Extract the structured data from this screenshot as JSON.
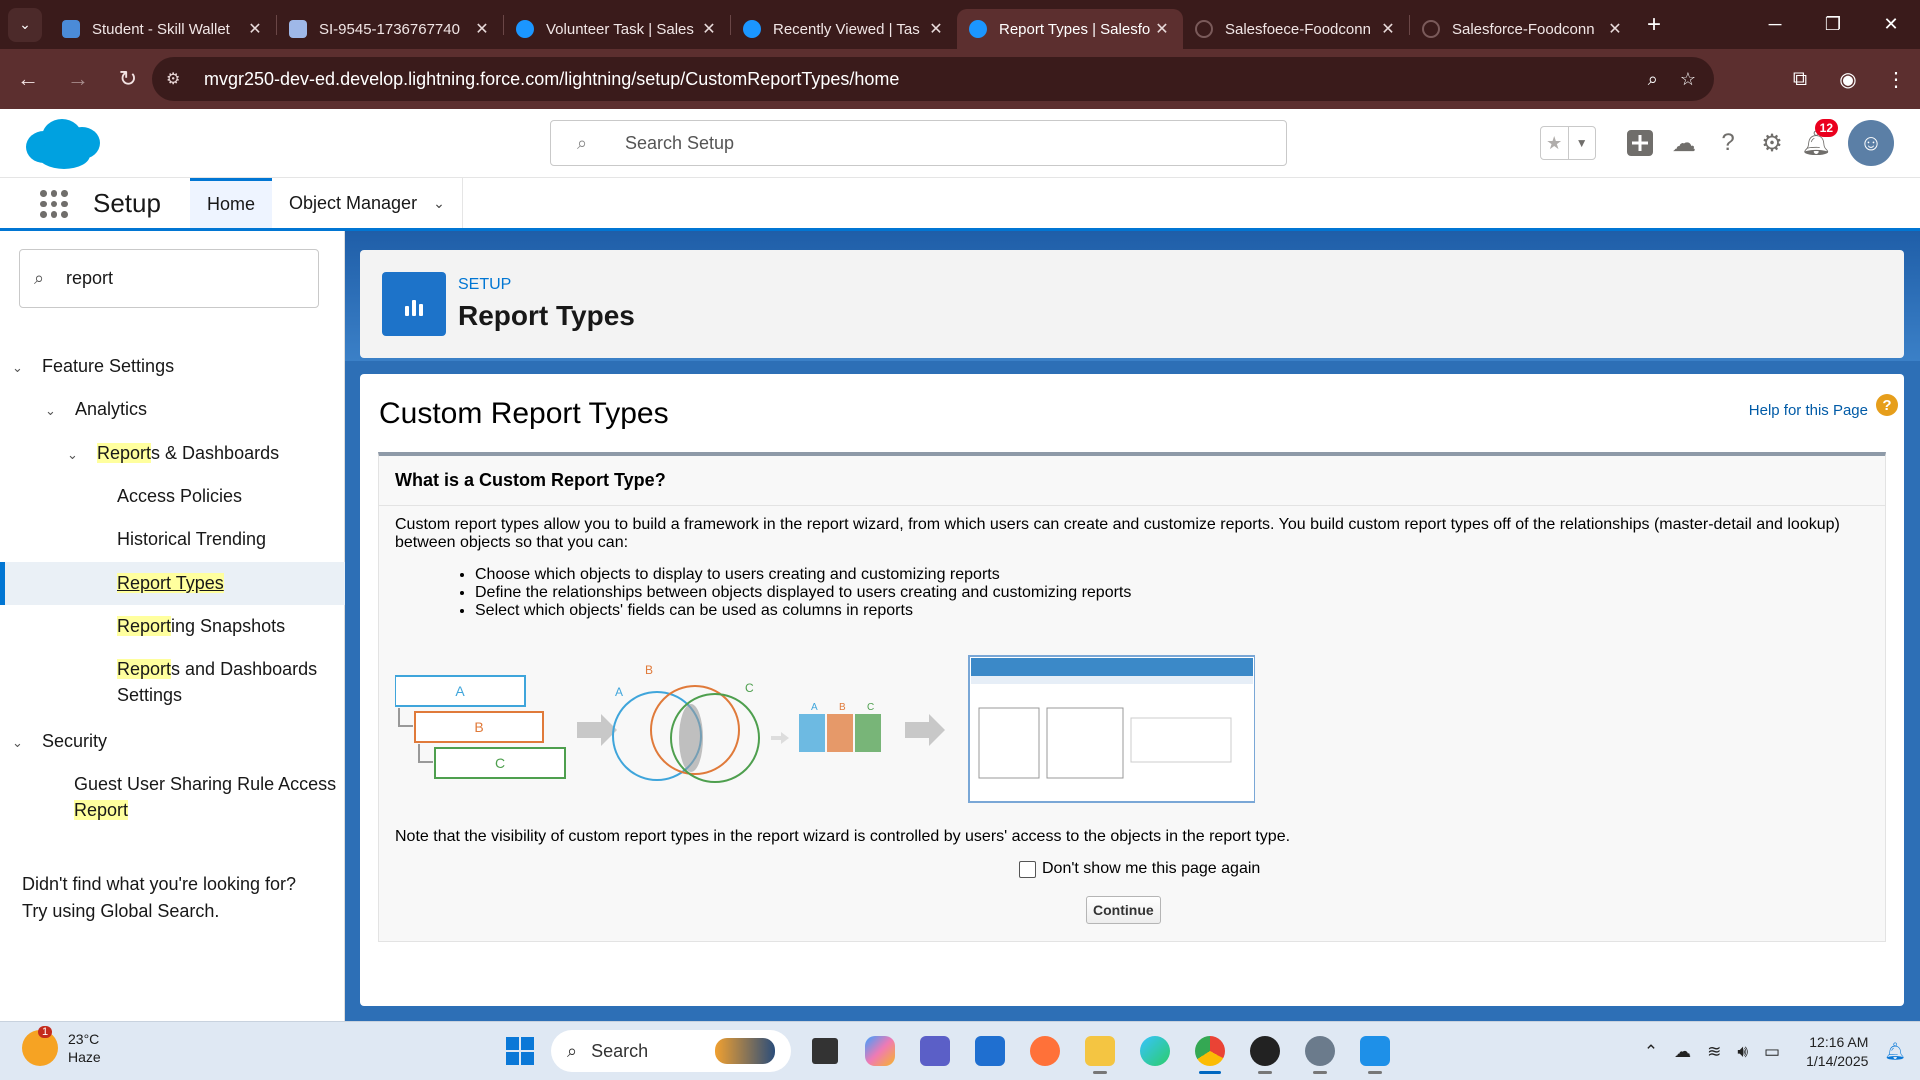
{
  "browser": {
    "tabs": [
      {
        "label": "Student - Skill Wallet",
        "icon_color": "#4b8bd8",
        "active": false
      },
      {
        "label": "SI-9545-1736767740",
        "icon_color": "#9fb8e8",
        "active": false
      },
      {
        "label": "Volunteer Task | Sales",
        "icon_color": "#1b96ff",
        "active": false
      },
      {
        "label": "Recently Viewed | Tas",
        "icon_color": "#1b96ff",
        "active": false
      },
      {
        "label": "Report Types | Salesfo",
        "icon_color": "#1b96ff",
        "active": true
      },
      {
        "label": "Salesfoece-Foodconn",
        "icon_color": "#3a1b1b",
        "active": false
      },
      {
        "label": "Salesforce-Foodconn",
        "icon_color": "#3a1b1b",
        "active": false
      }
    ],
    "url": "mvgr250-dev-ed.develop.lightning.force.com/lightning/setup/CustomReportTypes/home"
  },
  "sf_header": {
    "search_placeholder": "Search Setup",
    "notification_count": "12"
  },
  "app_nav": {
    "app_name": "Setup",
    "tabs": [
      "Home",
      "Object Manager"
    ]
  },
  "sidebar": {
    "quick_find_value": "report",
    "tree": {
      "feature_settings": "Feature Settings",
      "analytics": "Analytics",
      "reports_dash_hl": "Report",
      "reports_dash_rest": "s & Dashboards",
      "access_policies": "Access Policies",
      "historical_trending": "Historical Trending",
      "report_types": "Report Types",
      "reporting_hl": "Report",
      "reporting_rest": "ing Snapshots",
      "reports_and_dash_hl": "Report",
      "reports_and_dash_rest": "s and Dashboards",
      "reports_and_dash_line2": "Settings",
      "security": "Security",
      "guest_user_line1": "Guest User Sharing Rule Access",
      "guest_user_line2_hl": "Report"
    },
    "help_line1": "Didn't find what you're looking for?",
    "help_line2": "Try using Global Search."
  },
  "page_header": {
    "eyebrow": "SETUP",
    "title": "Report Types"
  },
  "main": {
    "title": "Custom Report Types",
    "help_link": "Help for this Page",
    "info_heading": "What is a Custom Report Type?",
    "intro": "Custom report types allow you to build a framework in the report wizard, from which users can create and customize reports. You build custom report types off of the relationships (master-detail and lookup) between objects so that you can:",
    "bullets": [
      "Choose which objects to display to users creating and customizing reports",
      "Define the relationships between objects displayed to users creating and customizing reports",
      "Select which objects' fields can be used as columns in reports"
    ],
    "diagram_labels": {
      "a": "A",
      "b": "B",
      "c": "C"
    },
    "note": "Note that the visibility of custom report types in the report wizard is controlled by users' access to the objects in the report type.",
    "dont_show": "Don't show me this page again",
    "continue": "Continue"
  },
  "taskbar": {
    "weather_temp": "23°C",
    "weather_desc": "Haze",
    "weather_badge": "1",
    "search_label": "Search",
    "time": "12:16 AM",
    "date": "1/14/2025"
  }
}
